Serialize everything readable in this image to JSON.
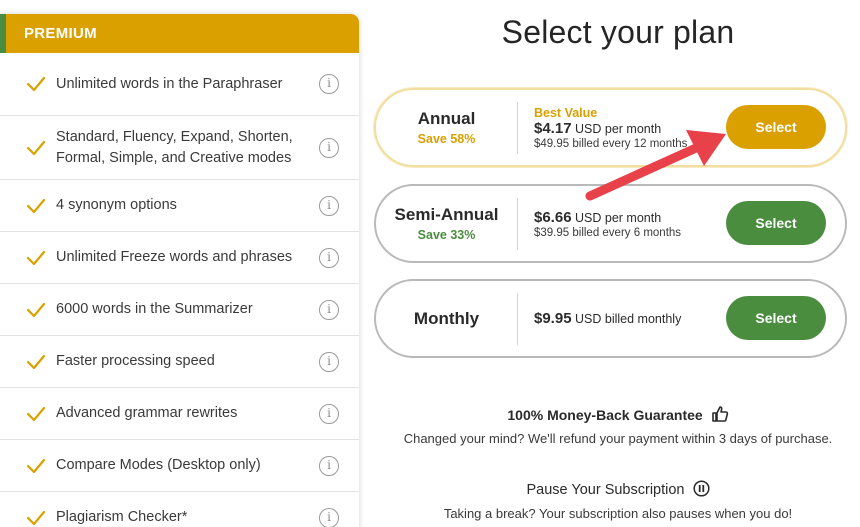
{
  "features": {
    "header": "PREMIUM",
    "items": [
      {
        "text": "Unlimited words in the Paraphraser"
      },
      {
        "text": "Standard, Fluency, Expand, Shorten, Formal, Simple, and Creative modes"
      },
      {
        "text": "4 synonym options"
      },
      {
        "text": "Unlimited Freeze words and phrases"
      },
      {
        "text": "6000 words in the Summarizer"
      },
      {
        "text": "Faster processing speed"
      },
      {
        "text": "Advanced grammar rewrites"
      },
      {
        "text": "Compare Modes (Desktop only)"
      },
      {
        "text": "Plagiarism Checker*"
      }
    ],
    "info_glyph": "i"
  },
  "title": "Select your plan",
  "plans": {
    "annual": {
      "name": "Annual",
      "save": "Save 58%",
      "badge": "Best Value",
      "price": "$4.17",
      "price_suffix": "USD per month",
      "billed": "$49.95 billed every 12 months",
      "button": "Select"
    },
    "semi": {
      "name": "Semi-Annual",
      "save": "Save 33%",
      "price": "$6.66",
      "price_suffix": "USD per month",
      "billed": "$39.95 billed every 6 months",
      "button": "Select"
    },
    "monthly": {
      "name": "Monthly",
      "price": "$9.95",
      "price_suffix": "USD billed monthly",
      "button": "Select"
    }
  },
  "guarantee": {
    "title": "100% Money-Back Guarantee",
    "text": "Changed your mind? We'll refund your payment within 3 days of purchase."
  },
  "pause": {
    "title": "Pause Your Subscription",
    "text": "Taking a break? Your subscription also pauses when you do!"
  },
  "colors": {
    "premium": "#d9a000",
    "green": "#4a8d3f",
    "arrow": "#e8414a"
  },
  "icons": {
    "check": "check-icon",
    "info": "info-icon",
    "thumbs_up": "thumbs-up-icon",
    "pause": "pause-icon",
    "arrow": "annotation-arrow"
  }
}
